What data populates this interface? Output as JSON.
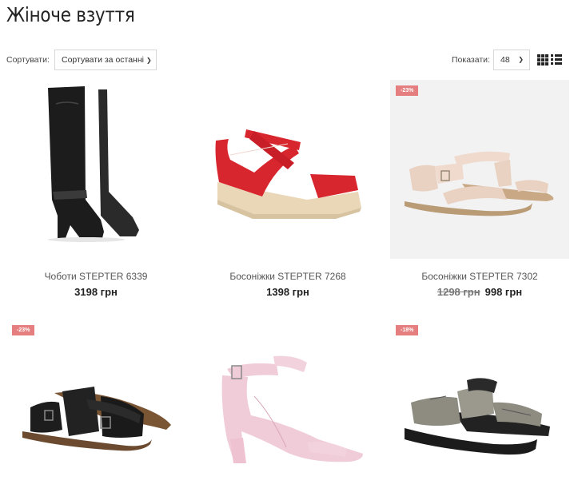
{
  "page": {
    "title": "Жіноче взуття"
  },
  "toolbar": {
    "sort_label": "Сортувати:",
    "sort_value": "Сортувати за останні",
    "show_label": "Показати:",
    "show_value": "48",
    "view_modes": [
      "grid",
      "list"
    ]
  },
  "colors": {
    "badge": "#e57f7f",
    "accent_text": "#222222"
  },
  "products": [
    {
      "name": "Чоботи STEPTER 6339",
      "price": "3198 грн",
      "old_price": "",
      "badge": "",
      "icon": "black-boot"
    },
    {
      "name": "Босоніжки STEPTER 7268",
      "price": "1398 грн",
      "old_price": "",
      "badge": "",
      "icon": "red-wedge-sandal"
    },
    {
      "name": "Босоніжки STEPTER 7302",
      "price": "998 грн",
      "old_price": "1298 грн",
      "badge": "-23%",
      "icon": "beige-flat-sandal"
    },
    {
      "name": "",
      "price": "",
      "old_price": "",
      "badge": "-23%",
      "icon": "black-flat-sandal"
    },
    {
      "name": "",
      "price": "",
      "old_price": "",
      "badge": "",
      "icon": "pink-heel-sandal"
    },
    {
      "name": "",
      "price": "",
      "old_price": "",
      "badge": "-18%",
      "icon": "grey-sport-sandal"
    }
  ]
}
